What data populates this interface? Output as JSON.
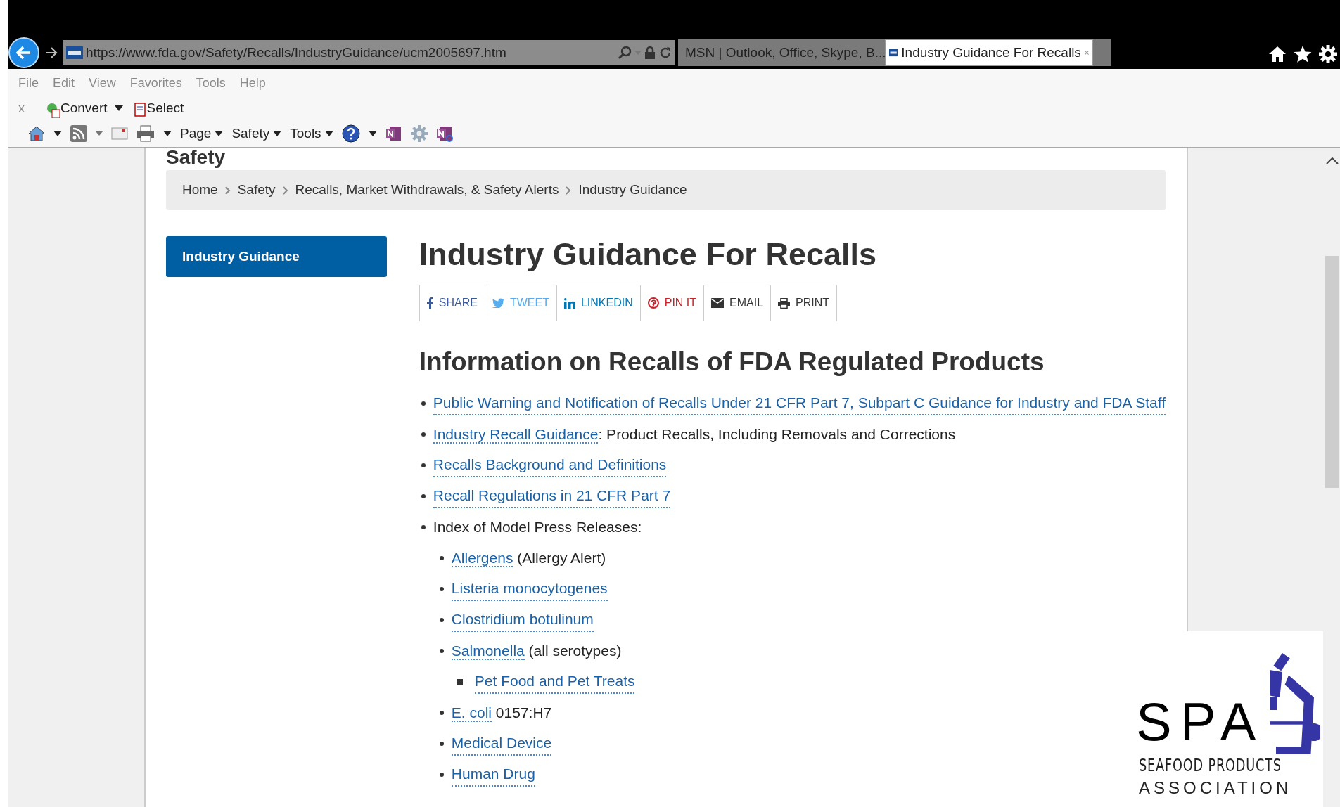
{
  "browser": {
    "url": "https://www.fda.gov/Safety/Recalls/IndustryGuidance/ucm2005697.htm",
    "tabs": [
      {
        "label": "MSN | Outlook, Office, Skype, B...",
        "selected": false,
        "kind": "msn"
      },
      {
        "label": "Industry Guidance For Recalls",
        "selected": true,
        "kind": "fda"
      }
    ],
    "menu": [
      "File",
      "Edit",
      "View",
      "Favorites",
      "Tools",
      "Help"
    ],
    "toolbar_1": [
      {
        "kind": "close",
        "label": "x"
      },
      {
        "kind": "convert",
        "label": "Convert"
      },
      {
        "kind": "select",
        "label": "Select"
      }
    ],
    "toolbar_2": [
      {
        "kind": "home"
      },
      {
        "kind": "feed"
      },
      {
        "kind": "mail"
      },
      {
        "kind": "print"
      },
      {
        "kind": "menu",
        "label": "Page"
      },
      {
        "kind": "menu",
        "label": "Safety"
      },
      {
        "kind": "menu",
        "label": "Tools"
      },
      {
        "kind": "help"
      },
      {
        "kind": "onenote"
      },
      {
        "kind": "gear"
      },
      {
        "kind": "onenote-link"
      }
    ]
  },
  "page": {
    "section_heading": "Safety",
    "breadcrumb": [
      "Home",
      "Safety",
      "Recalls, Market Withdrawals, & Safety Alerts",
      "Industry Guidance"
    ],
    "sidebar": [
      {
        "label": "Industry Guidance",
        "selected": true
      }
    ],
    "title": "Industry Guidance For Recalls",
    "share": [
      {
        "kind": "facebook",
        "label": "SHARE",
        "color": "#3b5998"
      },
      {
        "kind": "twitter",
        "label": "TWEET",
        "color": "#55acee"
      },
      {
        "kind": "linkedin",
        "label": "LINKEDIN",
        "color": "#0077b5"
      },
      {
        "kind": "pinterest",
        "label": "PIN IT",
        "color": "#cb2027"
      },
      {
        "kind": "email",
        "label": "EMAIL",
        "color": "#333333"
      },
      {
        "kind": "print",
        "label": "PRINT",
        "color": "#333333"
      }
    ],
    "heading": "Information on Recalls of FDA Regulated Products",
    "items": [
      {
        "link": "Public Warning and Notification of Recalls Under 21 CFR Part 7, Subpart C Guidance for Industry and FDA Staff"
      },
      {
        "link": "Industry Recall Guidance",
        "text": ": Product Recalls, Including Removals and Corrections"
      },
      {
        "link": "Recalls Background and Definitions"
      },
      {
        "link": "Recall Regulations in 21 CFR Part 7"
      },
      {
        "text": "Index of Model Press Releases:",
        "children": [
          {
            "link": "Allergens",
            "text": " (Allergy Alert)"
          },
          {
            "link": "Listeria monocytogenes"
          },
          {
            "link": "Clostridium botulinum"
          },
          {
            "link": "Salmonella",
            "text": " (all serotypes)",
            "children": [
              {
                "link": "Pet Food and Pet Treats"
              }
            ]
          },
          {
            "link": "E. coli",
            "text": " 0157:H7"
          },
          {
            "link": "Medical Device"
          },
          {
            "link": "Human Drug"
          }
        ]
      }
    ]
  },
  "overlay_logo": {
    "initials": "SPA",
    "name_line_1": "SEAFOOD PRODUCTS",
    "name_line_2": "ASSOCIATION"
  }
}
